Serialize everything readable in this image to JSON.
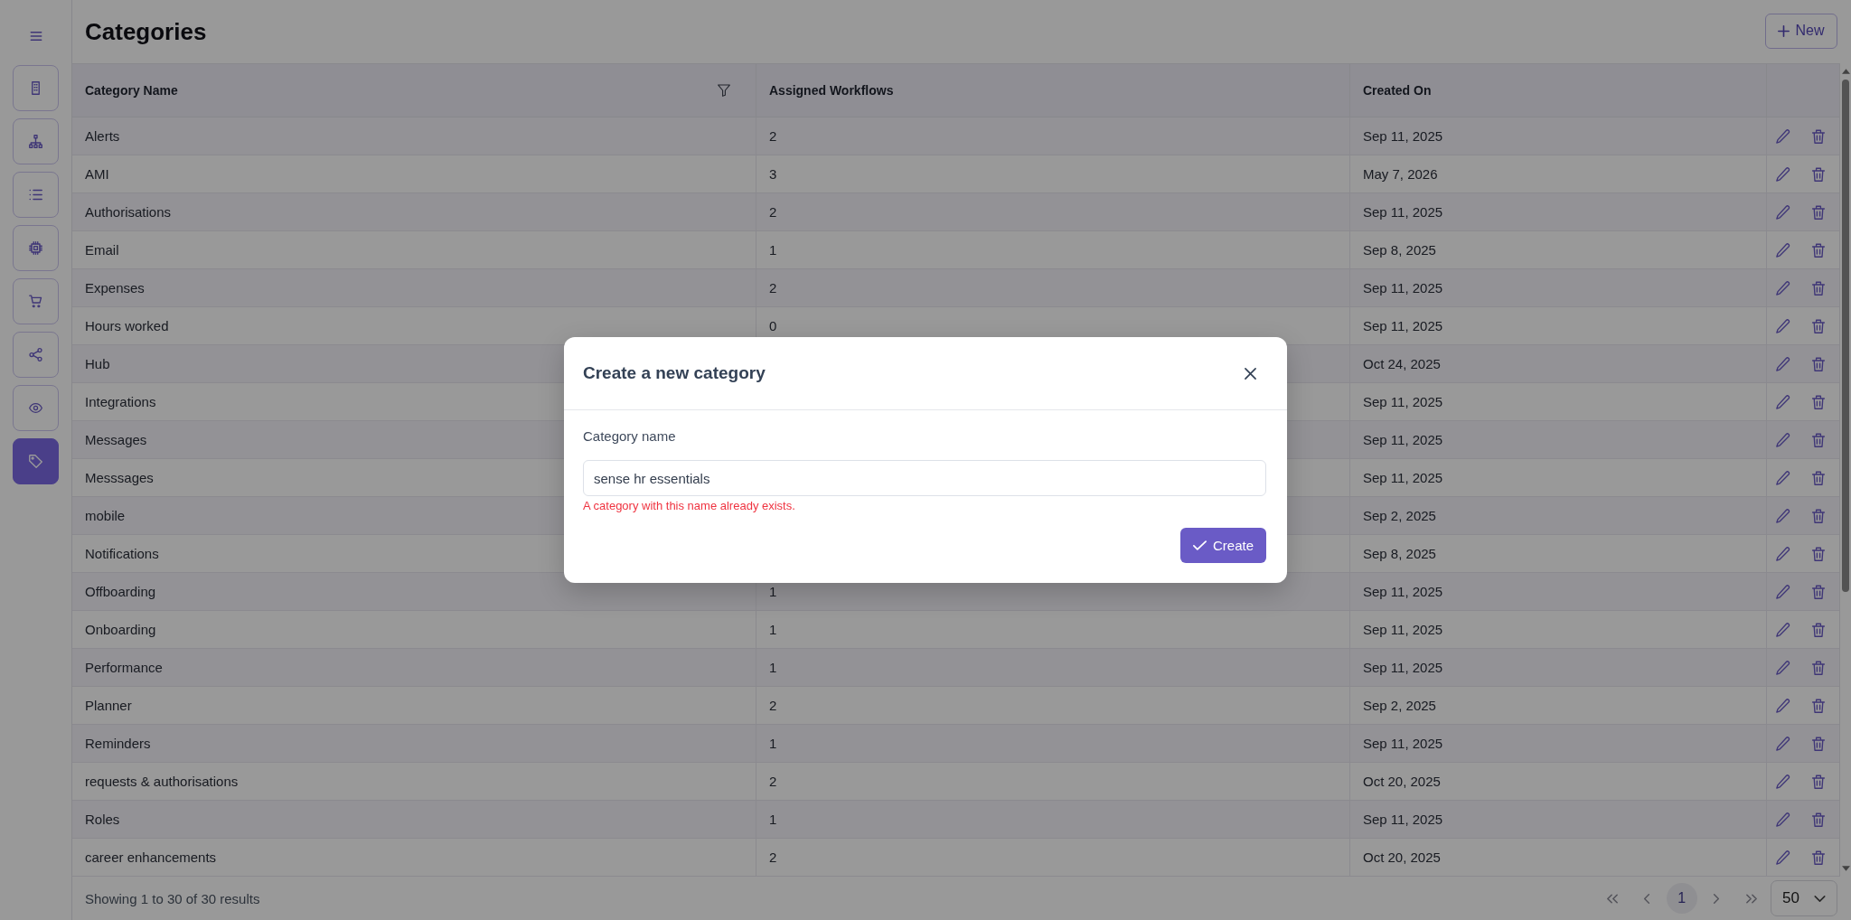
{
  "sidebar": {
    "items": [
      {
        "selected": false
      },
      {
        "selected": false
      },
      {
        "selected": false
      },
      {
        "selected": false
      },
      {
        "selected": false
      },
      {
        "selected": false
      },
      {
        "selected": false
      },
      {
        "selected": true
      }
    ]
  },
  "header": {
    "title": "Categories",
    "new_button": "New"
  },
  "table": {
    "columns": [
      {
        "label": "Category Name",
        "filterable": true
      },
      {
        "label": "Assigned Workflows",
        "filterable": false
      },
      {
        "label": "Created On",
        "filterable": false
      }
    ],
    "rows": [
      {
        "name": "Alerts",
        "workflows": "2",
        "created": "Sep 11, 2025"
      },
      {
        "name": "AMI",
        "workflows": "3",
        "created": "May 7, 2026"
      },
      {
        "name": "Authorisations",
        "workflows": "2",
        "created": "Sep 11, 2025"
      },
      {
        "name": "Email",
        "workflows": "1",
        "created": "Sep 8, 2025"
      },
      {
        "name": "Expenses",
        "workflows": "2",
        "created": "Sep 11, 2025"
      },
      {
        "name": "Hours worked",
        "workflows": "0",
        "created": "Sep 11, 2025"
      },
      {
        "name": "Hub",
        "created": "Oct 24, 2025"
      },
      {
        "name": "Integrations",
        "created": "Sep 11, 2025"
      },
      {
        "name": "Messages",
        "created": "Sep 11, 2025"
      },
      {
        "name": "Messsages",
        "created": "Sep 11, 2025"
      },
      {
        "name": "mobile",
        "created": "Sep 2, 2025"
      },
      {
        "name": "Notifications",
        "created": "Sep 8, 2025"
      },
      {
        "name": "Offboarding",
        "workflows": "1",
        "created": "Sep 11, 2025"
      },
      {
        "name": "Onboarding",
        "workflows": "1",
        "created": "Sep 11, 2025"
      },
      {
        "name": "Performance",
        "workflows": "1",
        "created": "Sep 11, 2025"
      },
      {
        "name": "Planner",
        "workflows": "2",
        "created": "Sep 2, 2025"
      },
      {
        "name": "Reminders",
        "workflows": "1",
        "created": "Sep 11, 2025"
      },
      {
        "name": "requests & authorisations",
        "workflows": "2",
        "created": "Oct 20, 2025"
      },
      {
        "name": "Roles",
        "workflows": "1",
        "created": "Sep 11, 2025"
      },
      {
        "name": "career enhancements",
        "workflows": "2",
        "created": "Oct 20, 2025"
      }
    ]
  },
  "footer": {
    "summary": "Showing 1 to 30 of 30 results",
    "pagination": {
      "pages": [
        {
          "label": "1",
          "selected": true
        }
      ],
      "page_size": "50"
    }
  },
  "modal": {
    "title": "Create a new category",
    "field_label": "Category name",
    "value": "sense hr essentials",
    "error": "A category with this name already exists.",
    "submit_button": "Create"
  }
}
